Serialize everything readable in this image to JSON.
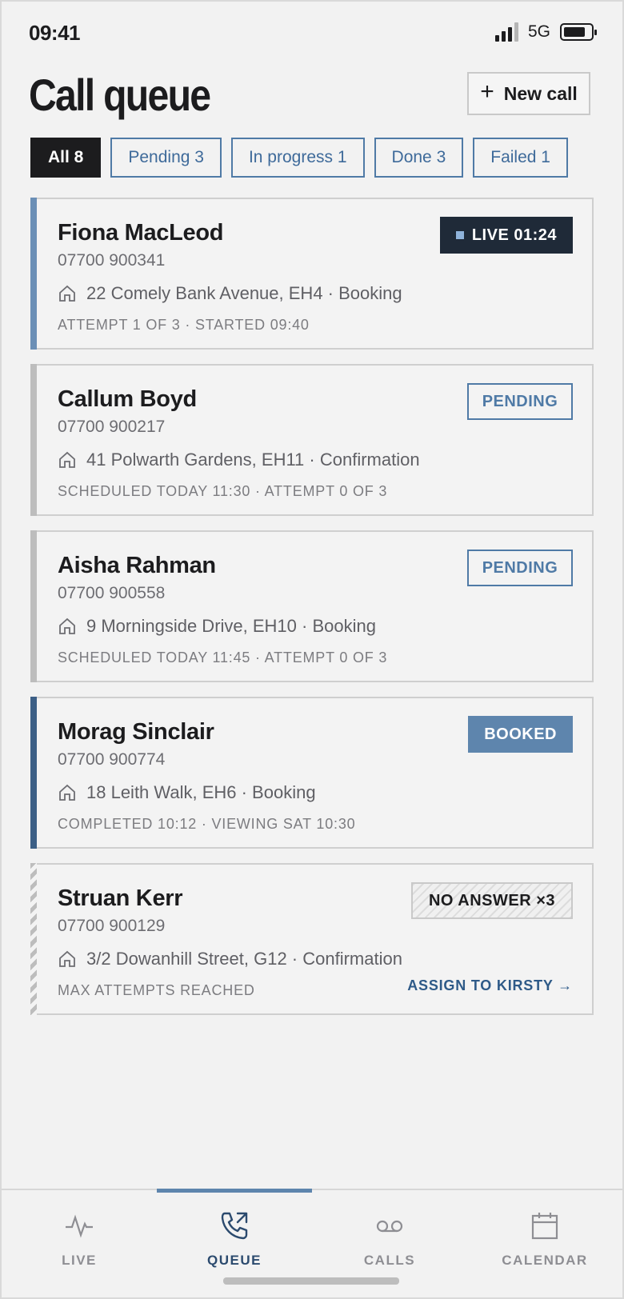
{
  "status": {
    "time": "09:41",
    "network": "5G"
  },
  "header": {
    "title": "Call queue",
    "new_call_label": "New call"
  },
  "filters": [
    {
      "label": "All 8",
      "active": true
    },
    {
      "label": "Pending 3",
      "active": false
    },
    {
      "label": "In progress 1",
      "active": false
    },
    {
      "label": "Done 3",
      "active": false
    },
    {
      "label": "Failed 1",
      "active": false
    }
  ],
  "calls": [
    {
      "name": "Fiona MacLeod",
      "phone": "07700 900341",
      "address": "22 Comely Bank Avenue, EH4 · Booking",
      "meta": "ATTEMPT 1 OF 3 · STARTED 09:40",
      "badge": "LIVE 01:24",
      "status": "live"
    },
    {
      "name": "Callum Boyd",
      "phone": "07700 900217",
      "address": "41 Polwarth Gardens, EH11 · Confirmation",
      "meta": "SCHEDULED TODAY 11:30 · ATTEMPT 0 OF 3",
      "badge": "PENDING",
      "status": "pending"
    },
    {
      "name": "Aisha Rahman",
      "phone": "07700 900558",
      "address": "9 Morningside Drive, EH10 · Booking",
      "meta": "SCHEDULED TODAY 11:45 · ATTEMPT 0 OF 3",
      "badge": "PENDING",
      "status": "pending"
    },
    {
      "name": "Morag Sinclair",
      "phone": "07700 900774",
      "address": "18 Leith Walk, EH6 · Booking",
      "meta": "COMPLETED 10:12 · VIEWING SAT 10:30",
      "badge": "BOOKED",
      "status": "booked"
    },
    {
      "name": "Struan Kerr",
      "phone": "07700 900129",
      "address": "3/2 Dowanhill Street, G12 · Confirmation",
      "meta": "MAX ATTEMPTS REACHED",
      "badge": "NO ANSWER ×3",
      "status": "failed",
      "action": "ASSIGN TO KIRSTY →"
    }
  ],
  "tabs": [
    {
      "label": "LIVE",
      "icon": "pulse-icon"
    },
    {
      "label": "QUEUE",
      "icon": "phone-outgoing-icon",
      "active": true
    },
    {
      "label": "CALLS",
      "icon": "voicemail-icon"
    },
    {
      "label": "CALENDAR",
      "icon": "calendar-icon"
    }
  ],
  "colors": {
    "accent": "#5e85ad",
    "dark": "#1f2a38",
    "background": "#f2f2f2"
  }
}
